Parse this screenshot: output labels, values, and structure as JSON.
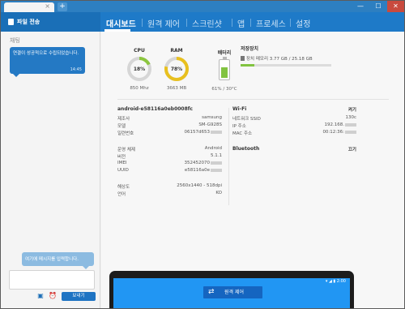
{
  "titlebar": {
    "tab_label": "",
    "close_glyph": "×",
    "new_tab_glyph": "+",
    "min_glyph": "—",
    "max_glyph": "☐",
    "close_window_glyph": "✕"
  },
  "header": {
    "file_transfer": "파일 전송",
    "tabs": [
      {
        "label": "대시보드",
        "active": true
      },
      {
        "label": "원격 제어",
        "active": false
      },
      {
        "label": "스크린샷",
        "active": false
      },
      {
        "label": "앱",
        "active": false
      },
      {
        "label": "프로세스",
        "active": false
      },
      {
        "label": "설정",
        "active": false
      }
    ],
    "accent_color": "#1e7ac8"
  },
  "chat": {
    "title": "채팅",
    "message": "연결이 성공적으로 수립되었습니다.",
    "message_time": "14:45",
    "input_hint": "여기에 메시지를 입력합니다.",
    "input_value": "",
    "send_label": "보내기",
    "tools": [
      "image-icon",
      "alarm-icon"
    ]
  },
  "dashboard": {
    "cpu": {
      "label": "CPU",
      "value": "18%",
      "percent": 18,
      "sub": "850 Mhz",
      "color": "#8cc63f"
    },
    "ram": {
      "label": "RAM",
      "value": "78%",
      "percent": 78,
      "sub": "3663 MB",
      "color": "#e8c01f"
    },
    "battery": {
      "label": "배터리",
      "percent": 61,
      "sub": "61% / 30°C",
      "color": "#82c341"
    },
    "storage": {
      "title": "저장장치",
      "row": "장치 메모리 3.77 GB / 25.18 GB",
      "percent": 15
    }
  },
  "device": {
    "name": "android-e58116a0eb0008fc",
    "rows": [
      {
        "k": "제조사",
        "v": "samsung"
      },
      {
        "k": "모델",
        "v": "SM-G928S"
      },
      {
        "k": "일련번호",
        "v": "06157d653"
      }
    ],
    "os": [
      {
        "k": "운영 체제",
        "v": "Android"
      },
      {
        "k": "버전",
        "v": "5.1.1"
      },
      {
        "k": "IMEI",
        "v": "352452070"
      },
      {
        "k": "UUID",
        "v": "e58116a0e"
      }
    ],
    "display": [
      {
        "k": "해상도",
        "v": "2560x1440 - 518dpi"
      },
      {
        "k": "언어",
        "v": "KO"
      }
    ]
  },
  "network": {
    "wifi": {
      "title": "Wi-Fi",
      "state": "켜기"
    },
    "wifi_rows": [
      {
        "k": "네트워크 SSID",
        "v": "130c"
      },
      {
        "k": "IP 주소",
        "v": "192.168."
      },
      {
        "k": "MAC 주소",
        "v": "00:12:36:"
      }
    ],
    "bluetooth": {
      "title": "Bluetooth",
      "state": "끄기"
    }
  },
  "phone": {
    "remote_label": "원격 제어",
    "status": "▾ ◢ ▮ 2:00"
  }
}
